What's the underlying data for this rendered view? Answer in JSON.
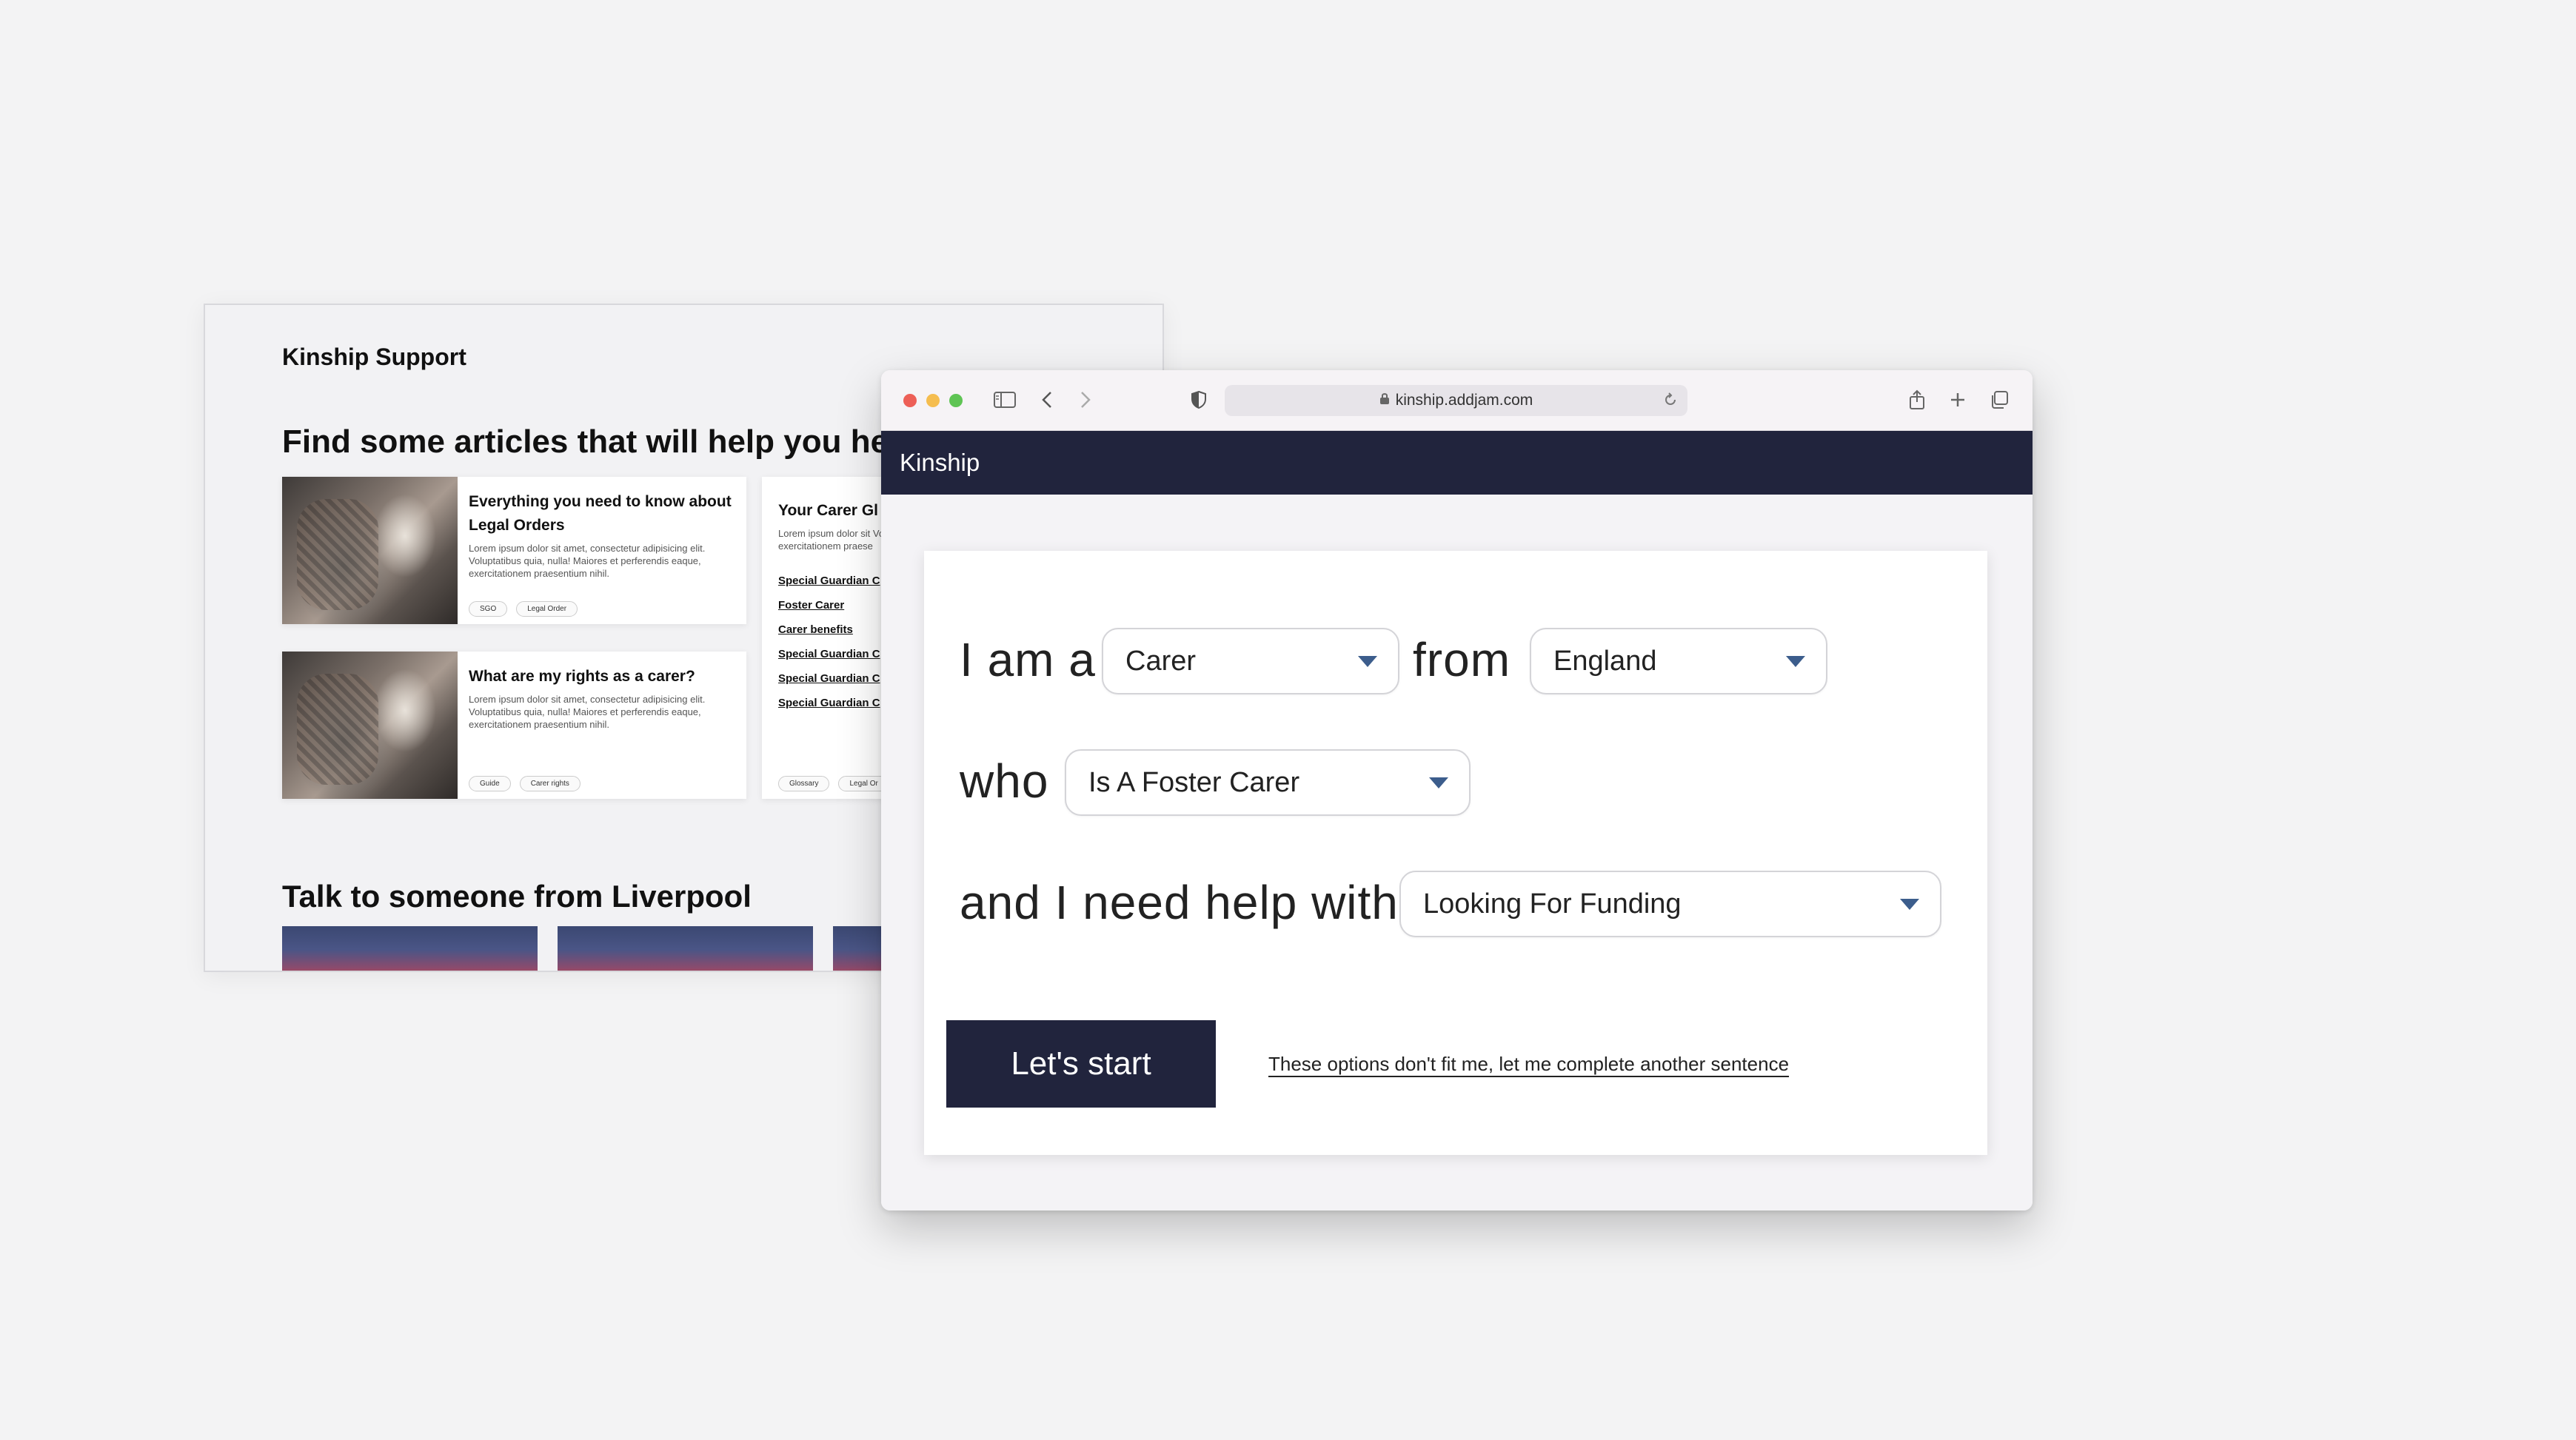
{
  "background_page": {
    "brand": "Kinship Support",
    "heading": "Find some articles that will help you her",
    "cards": [
      {
        "title": "Everything you need to know about Legal Orders",
        "text": "Lorem ipsum dolor sit amet, consectetur adipisicing elit. Voluptatibus quia, nulla! Maiores et perferendis eaque, exercitationem praesentium nihil.",
        "tags": [
          "SGO",
          "Legal Order"
        ]
      },
      {
        "title": "What are my rights as a carer?",
        "text": "Lorem ipsum dolor sit amet, consectetur adipisicing elit. Voluptatibus quia, nulla! Maiores et perferendis eaque, exercitationem praesentium nihil.",
        "tags": [
          "Guide",
          "Carer rights"
        ]
      }
    ],
    "glossary_card": {
      "title": "Your Carer Gl",
      "text": "Lorem ipsum dolor sit Voluptatibus quia, null exercitationem praese",
      "links": [
        "Special Guardian C",
        "Foster Carer",
        "Carer benefits",
        "Special Guardian C",
        "Special Guardian C",
        "Special Guardian C"
      ],
      "tags": [
        "Glossary",
        "Legal Or"
      ]
    },
    "talk_heading": "Talk to someone from Liverpool"
  },
  "browser": {
    "url": "kinship.addjam.com",
    "icons": {
      "sidebar": "sidebar-icon",
      "back": "chevron-left-icon",
      "forward": "chevron-right-icon",
      "privacy": "shield-icon",
      "lock": "lock-icon",
      "reload": "reload-icon",
      "share": "share-icon",
      "new_tab": "plus-icon",
      "tabs": "tabs-overview-icon"
    }
  },
  "app": {
    "title": "Kinship",
    "sentence": {
      "word_i_am_a": "I am a",
      "role_value": "Carer",
      "word_from": "from",
      "region_value": "England",
      "word_who": "who",
      "status_value": "Is A Foster Carer",
      "word_need_help": "and I need help with",
      "need_value": "Looking For Funding"
    },
    "start_button": "Let's start",
    "alt_link": "These options don't fit me, let me complete another sentence"
  },
  "colors": {
    "navy": "#21243d",
    "caret": "#3c5d8c",
    "page_bg": "#f3f3f4"
  }
}
